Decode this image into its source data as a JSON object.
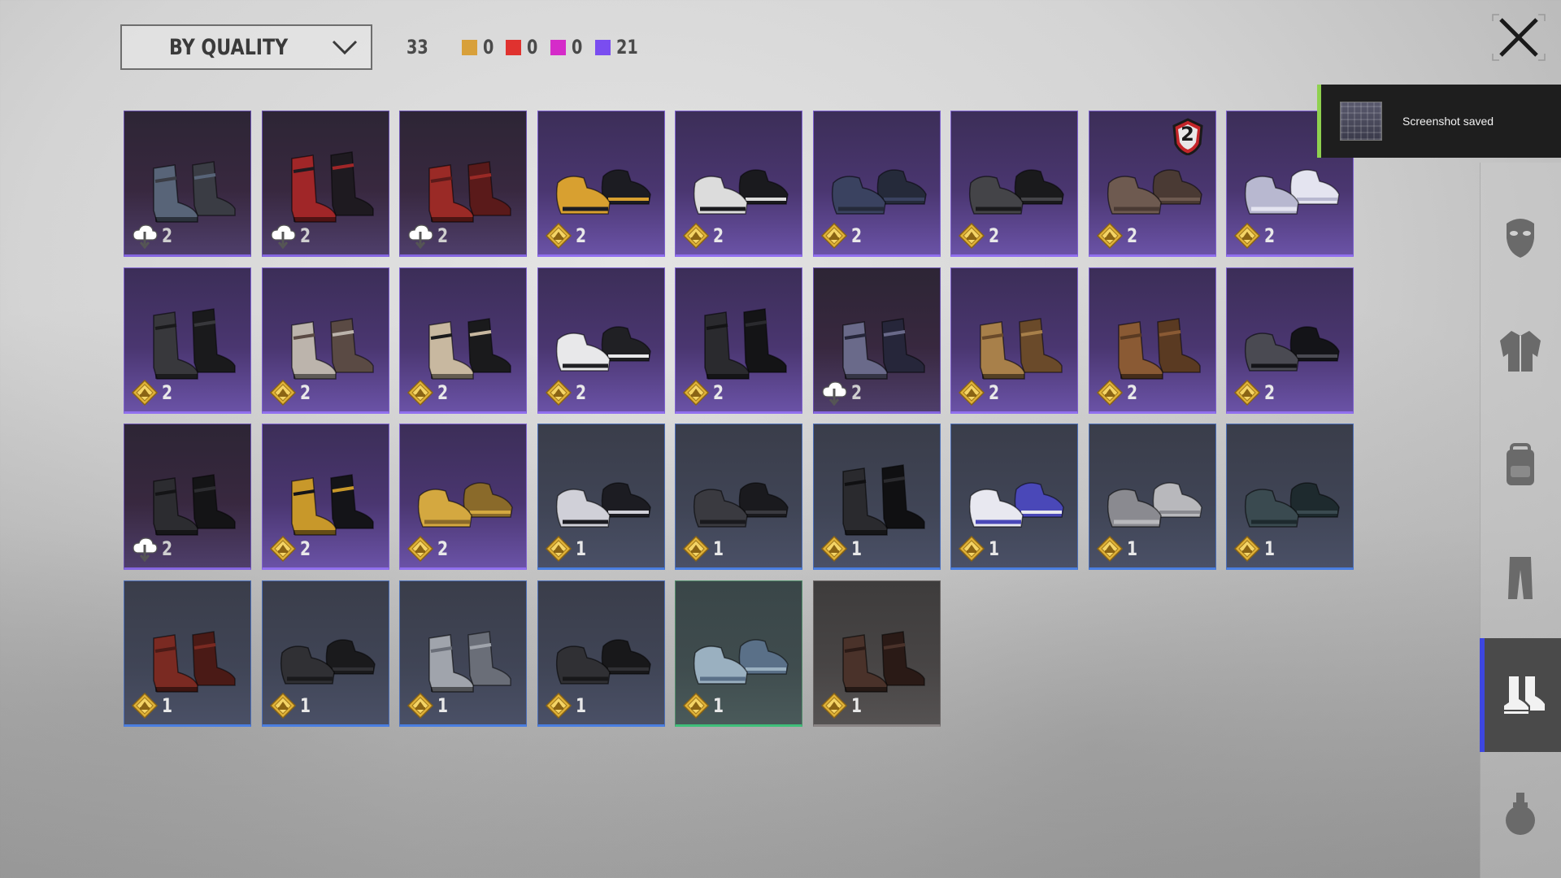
{
  "sort": {
    "label": "BY QUALITY"
  },
  "stats": {
    "total": "33",
    "qualities": [
      {
        "color": "#d8a03a",
        "value": "0"
      },
      {
        "color": "#e0322f",
        "value": "0"
      },
      {
        "color": "#d52bc9",
        "value": "0"
      },
      {
        "color": "#7a4df0",
        "value": "21"
      }
    ]
  },
  "notification": {
    "text": "Screenshot saved"
  },
  "sidebar": {
    "tabs": [
      {
        "name": "mask-icon",
        "active": false
      },
      {
        "name": "jacket-icon",
        "active": false
      },
      {
        "name": "backpack-icon",
        "active": false
      },
      {
        "name": "pants-icon",
        "active": false
      },
      {
        "name": "shoes-icon",
        "active": true
      },
      {
        "name": "potion-icon",
        "active": false
      }
    ]
  },
  "items": [
    {
      "quality": "purple-dark",
      "shoe": "short boots",
      "colors": [
        "#3a3c44",
        "#586478"
      ],
      "icon": "cloud",
      "count": "2"
    },
    {
      "quality": "purple-dark",
      "shoe": "red striped boots",
      "colors": [
        "#1e1a20",
        "#a02628"
      ],
      "icon": "cloud",
      "count": "2"
    },
    {
      "quality": "purple-dark",
      "shoe": "red boots",
      "colors": [
        "#5a1a1a",
        "#9a2a26"
      ],
      "icon": "cloud",
      "count": "2"
    },
    {
      "quality": "purple",
      "shoe": "sneakers gold",
      "colors": [
        "#1c1c22",
        "#d8a030"
      ],
      "icon": "gold",
      "count": "2"
    },
    {
      "quality": "purple",
      "shoe": "black high-tops",
      "colors": [
        "#1a1a1e",
        "#dcdcdc"
      ],
      "icon": "gold",
      "count": "2"
    },
    {
      "quality": "purple",
      "shoe": "loafers navy",
      "colors": [
        "#252a3a",
        "#3a4260"
      ],
      "icon": "gold",
      "count": "2"
    },
    {
      "quality": "purple",
      "shoe": "black combat",
      "colors": [
        "#1a1a1c",
        "#444448"
      ],
      "icon": "gold",
      "count": "2"
    },
    {
      "quality": "purple",
      "shoe": "brown moccasins",
      "colors": [
        "#4a3a34",
        "#6e5a50"
      ],
      "icon": "gold",
      "count": "2",
      "badge": "2"
    },
    {
      "quality": "purple",
      "shoe": "white sandals",
      "colors": [
        "#e4e4f0",
        "#b8b8d0"
      ],
      "icon": "gold",
      "count": "2"
    },
    {
      "quality": "purple",
      "shoe": "tall black boots",
      "colors": [
        "#1a1a1c",
        "#38383c"
      ],
      "icon": "gold",
      "count": "2"
    },
    {
      "quality": "purple",
      "shoe": "worn boots",
      "colors": [
        "#5a4a44",
        "#bcb4ac"
      ],
      "icon": "gold",
      "count": "2"
    },
    {
      "quality": "purple",
      "shoe": "fur boots",
      "colors": [
        "#1a1a1c",
        "#c8b8a0"
      ],
      "icon": "gold",
      "count": "2"
    },
    {
      "quality": "purple",
      "shoe": "canvas sneakers",
      "colors": [
        "#202024",
        "#e8e8ea"
      ],
      "icon": "gold",
      "count": "2"
    },
    {
      "quality": "purple",
      "shoe": "riding boots",
      "colors": [
        "#141416",
        "#2a2a2e"
      ],
      "icon": "gold",
      "count": "2"
    },
    {
      "quality": "purple-dark",
      "shoe": "armored boots",
      "colors": [
        "#26263a",
        "#6a6a8a"
      ],
      "icon": "cloud",
      "count": "2"
    },
    {
      "quality": "purple",
      "shoe": "tan lace boots",
      "colors": [
        "#6a4a2a",
        "#a8804a"
      ],
      "icon": "gold",
      "count": "2"
    },
    {
      "quality": "purple",
      "shoe": "buckle boots",
      "colors": [
        "#5a3a22",
        "#8a5a34"
      ],
      "icon": "gold",
      "count": "2"
    },
    {
      "quality": "purple",
      "shoe": "black trainers",
      "colors": [
        "#141418",
        "#4a4a52"
      ],
      "icon": "gold",
      "count": "2"
    },
    {
      "quality": "purple-dark",
      "shoe": "cuffed boots",
      "colors": [
        "#141416",
        "#2c2c30"
      ],
      "icon": "cloud",
      "count": "2"
    },
    {
      "quality": "purple",
      "shoe": "gold trim boots",
      "colors": [
        "#141418",
        "#c8982a"
      ],
      "icon": "gold",
      "count": "2"
    },
    {
      "quality": "purple",
      "shoe": "gold loafers",
      "colors": [
        "#8a6a2a",
        "#d4a840"
      ],
      "icon": "gold",
      "count": "2"
    },
    {
      "quality": "blue",
      "shoe": "low sneakers",
      "colors": [
        "#1c1c22",
        "#d0d0d8"
      ],
      "icon": "gold",
      "count": "1"
    },
    {
      "quality": "blue",
      "shoe": "oxfords",
      "colors": [
        "#1a1a1e",
        "#3a3a40"
      ],
      "icon": "gold",
      "count": "1"
    },
    {
      "quality": "blue",
      "shoe": "knee boots",
      "colors": [
        "#101012",
        "#2a2a2e"
      ],
      "icon": "gold",
      "count": "1"
    },
    {
      "quality": "blue",
      "shoe": "blue sneakers",
      "colors": [
        "#4a48b8",
        "#e8e8f0"
      ],
      "icon": "gold",
      "count": "1"
    },
    {
      "quality": "blue",
      "shoe": "grey slip-ons",
      "colors": [
        "#b8b8bc",
        "#8a8a90"
      ],
      "icon": "gold",
      "count": "1"
    },
    {
      "quality": "blue",
      "shoe": "dark runners",
      "colors": [
        "#1e2a2e",
        "#3a4a50"
      ],
      "icon": "gold",
      "count": "1"
    },
    {
      "quality": "blue",
      "shoe": "red boots",
      "colors": [
        "#4a1a16",
        "#7a2a22"
      ],
      "icon": "gold",
      "count": "1"
    },
    {
      "quality": "blue",
      "shoe": "black shoes",
      "colors": [
        "#1a1a1c",
        "#303034"
      ],
      "icon": "gold",
      "count": "1"
    },
    {
      "quality": "blue",
      "shoe": "grey boots",
      "colors": [
        "#6a6e78",
        "#a0a4ac"
      ],
      "icon": "gold",
      "count": "1"
    },
    {
      "quality": "blue",
      "shoe": "dress shoes",
      "colors": [
        "#18181a",
        "#303034"
      ],
      "icon": "gold",
      "count": "1"
    },
    {
      "quality": "green",
      "shoe": "denim sneakers",
      "colors": [
        "#5a7088",
        "#9ab0c0"
      ],
      "icon": "gold",
      "count": "1"
    },
    {
      "quality": "gray",
      "shoe": "brown work boots",
      "colors": [
        "#2a1a16",
        "#4a322a"
      ],
      "icon": "gold",
      "count": "1"
    }
  ]
}
